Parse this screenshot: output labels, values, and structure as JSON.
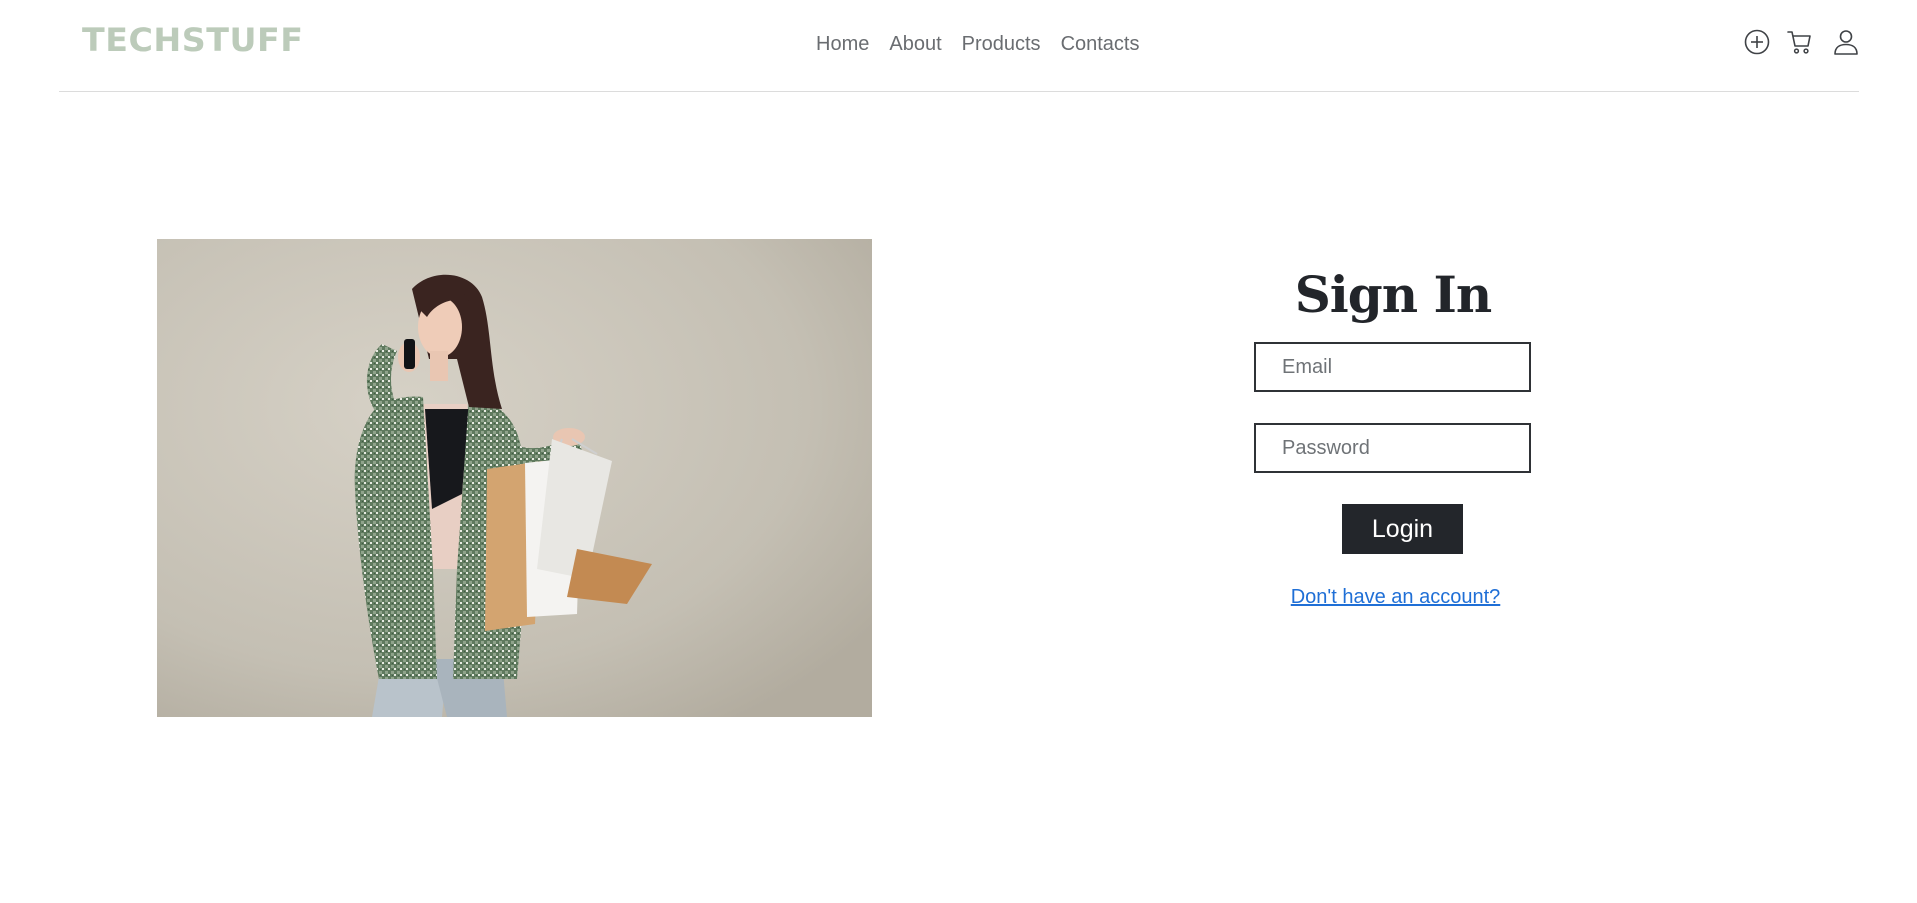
{
  "header": {
    "brand": "TECHSTUFF",
    "nav": [
      "Home",
      "About",
      "Products",
      "Contacts"
    ],
    "icons": [
      "add-circle-icon",
      "cart-icon",
      "user-icon"
    ]
  },
  "hero": {
    "image": "woman-with-shopping-bags-photo"
  },
  "signin": {
    "title": "Sign In",
    "email_placeholder": "Email",
    "password_placeholder": "Password",
    "login_label": "Login",
    "signup_link": "Don't have an account?"
  },
  "colors": {
    "brand": "#bccbba",
    "nav_text": "#6a6d71",
    "button_bg": "#23262b",
    "link": "#1f6fd6"
  }
}
